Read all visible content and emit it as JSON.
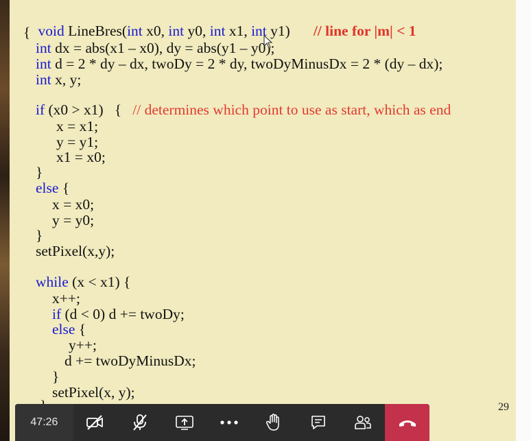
{
  "slide": {
    "header": {
      "kw1": "void",
      "t1": " LineBres(",
      "kw2": "int",
      "t2": " x0, ",
      "kw3": "int",
      "t3": " y0, ",
      "kw4": "int",
      "t4": " x1, ",
      "kw5": "int",
      "t5": " y1)",
      "comment": "// line for |m| < 1"
    },
    "open_brace": "{",
    "decl1": {
      "kw": "int",
      "t": " dx = abs(x1 – x0), dy = abs(y1 – y0);"
    },
    "decl2": {
      "kw": "int",
      "t": " d = 2 * dy – dx, twoDy = 2 * dy, twoDyMinusDx = 2 * (dy – dx);"
    },
    "decl3": {
      "kw": "int",
      "t": " x, y;"
    },
    "if_line": {
      "kw": "if",
      "t": " (x0 > x1)   {   ",
      "comment": "// determines which point to use as start, which as end"
    },
    "if_b1": "x = x1;",
    "if_b2": "y = y1;",
    "if_b3": "x1 = x0;",
    "close1": "}",
    "else_line": {
      "kw": "else",
      "t": " {"
    },
    "else_b1": "x = x0;",
    "else_b2": "y = y0;",
    "close2": "}",
    "setpixel1": "setPixel(x,y);",
    "while_line": {
      "kw": "while",
      "t": " (x < x1) {"
    },
    "w_b1": "x++;",
    "w_if": {
      "kw": "if",
      "t": " (d < 0) d += twoDy;"
    },
    "w_else": {
      "kw": "else",
      "t": " {"
    },
    "w_e1": "y++;",
    "w_e2": "d += twoDyMinusDx;",
    "close3": "}",
    "setpixel2": "setPixel(x, y);",
    "close4": "}",
    "number": "29"
  },
  "callbar": {
    "timer": "47:26",
    "icons": [
      "camera-off-icon",
      "mic-off-icon",
      "share-screen-icon",
      "more-icon",
      "raise-hand-icon",
      "chat-icon",
      "participants-icon",
      "hang-up-icon"
    ],
    "hangup_color": "#c4314b"
  }
}
